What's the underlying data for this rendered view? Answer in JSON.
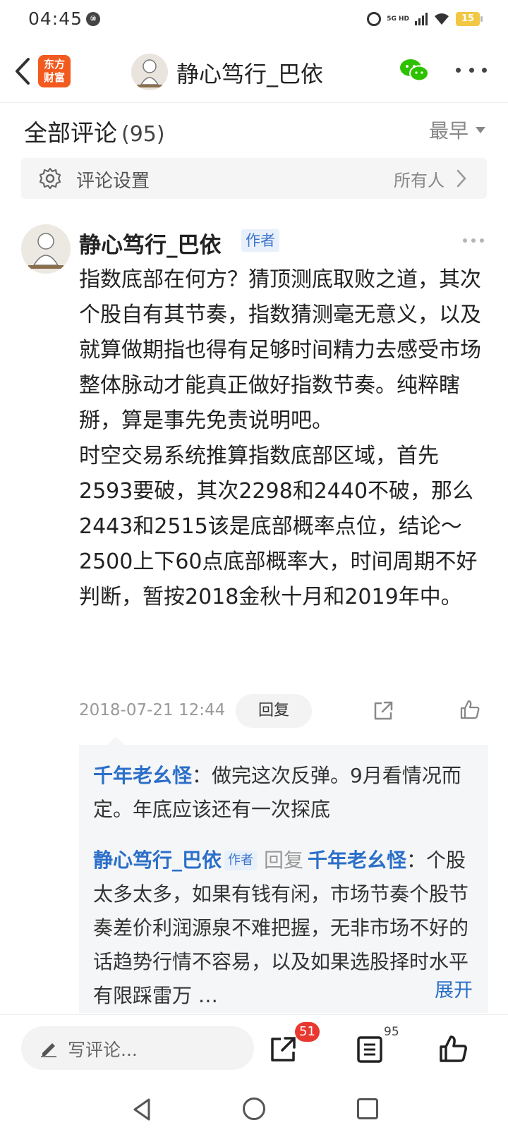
{
  "status_bar": {
    "time": "04:45",
    "circle_icon_text": "⑩",
    "network": "5G HD",
    "battery": "15"
  },
  "header": {
    "logo_line1": "东方",
    "logo_line2": "财富",
    "title": "静心笃行_巴依",
    "icons": [
      "back-arrow-icon",
      "avatar",
      "wechat-icon",
      "more-icon"
    ]
  },
  "comments": {
    "title": "全部评论",
    "count": "(95)",
    "sort_label": "最早",
    "settings_label": "评论设置",
    "settings_value": "所有人"
  },
  "comment": {
    "author": "静心笃行_巴依",
    "author_badge": "作者",
    "paragraph1": "指数底部在何方？猜顶测底取败之道，其次个股自有其节奏，指数猜测毫无意义，以及就算做期指也得有足够时间精力去感受市场整体脉动才能真正做好指数节奏。纯粹瞎掰，算是事先免责说明吧。",
    "paragraph2": "时空交易系统推算指数底部区域，首先2593要破，其次2298和2440不破，那么2443和2515该是底部概率点位，结论～2500上下60点底部概率大，时间周期不好判断，暂按2018金秋十月和2019年中。",
    "date": "2018-07-21 12:44",
    "reply_label": "回复"
  },
  "replies": [
    {
      "name": "千年老幺怪",
      "text": "：做完这次反弹。9月看情况而定。年底应该还有一次探底"
    },
    {
      "name": "静心笃行_巴依",
      "badge": "作者",
      "reply_word": "回复",
      "target": "千年老幺怪",
      "text": "：个股太多太多，如果有钱有闲，市场节奏个股节奏差价利润源泉不难把握，无非市场不好的话趋势行情不容易，以及如果选股择时水平有限踩雷万 …"
    }
  ],
  "expand_label": "展开",
  "bottom_bar": {
    "input_placeholder": "写评论...",
    "share_count": "51",
    "comment_count": "95"
  },
  "colors": {
    "link_blue": "#2b6fc9",
    "logo_orange": "#f25a1f",
    "wechat_green": "#2dc100",
    "badge_red": "#e8382f"
  }
}
